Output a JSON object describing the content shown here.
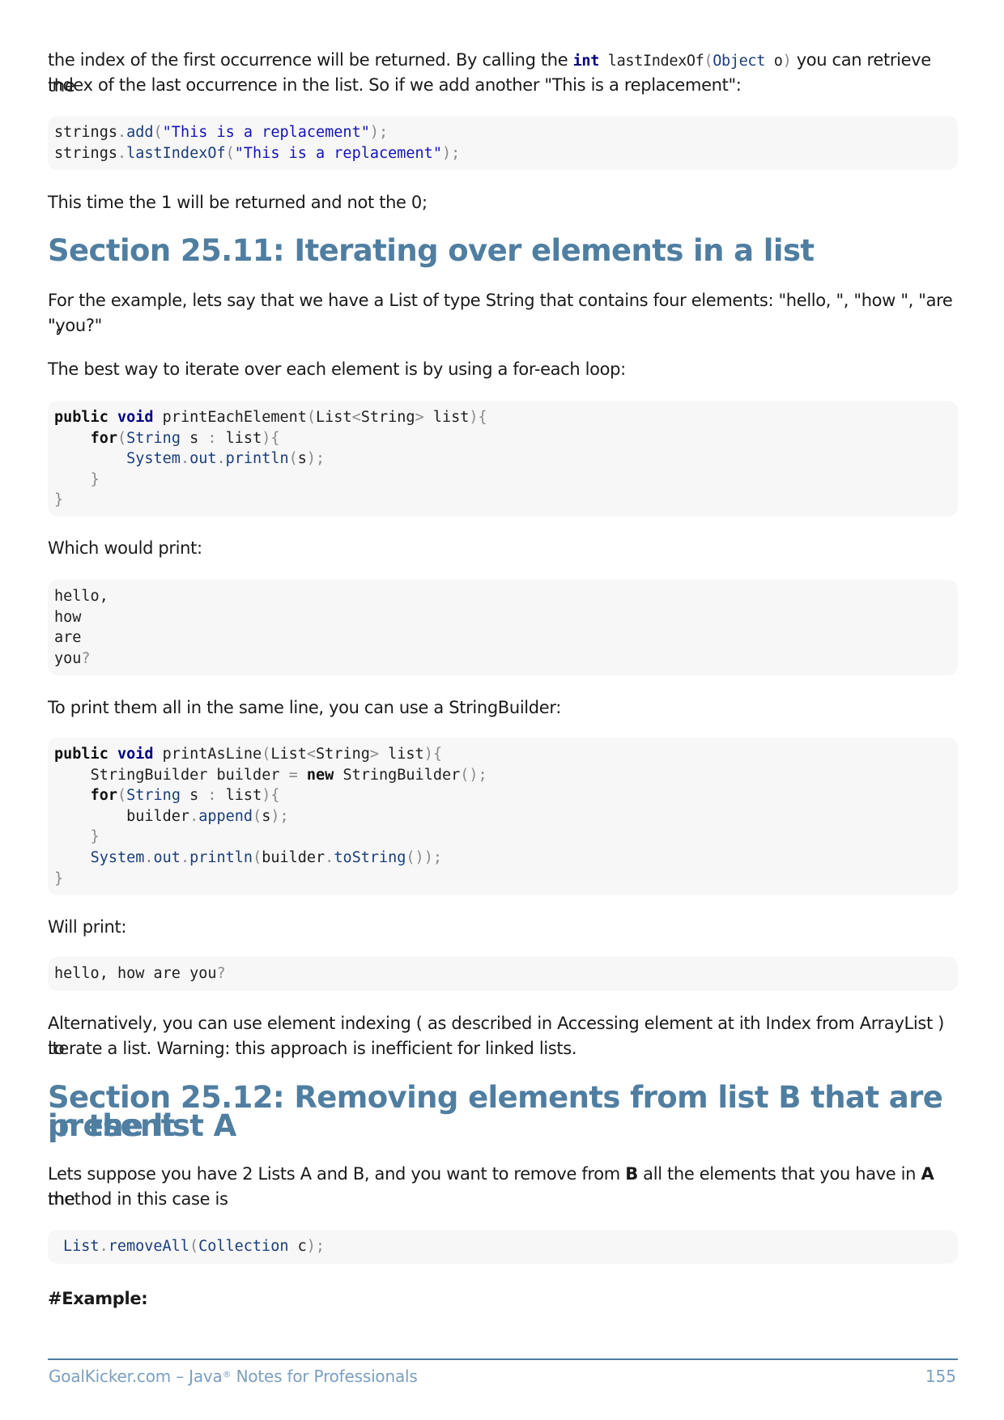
{
  "intro": {
    "line1_a": "the index of the first occurrence will be returned. By calling the ",
    "line1_kw": "int",
    "line1_fn": "lastIndexOf",
    "line1_open": "(",
    "line1_type": "Object",
    "line1_param": " o",
    "line1_close": ")",
    "line1_b": " you can retrieve the",
    "line2": "index of the last occurrence in the list. So if we add another \"This is a replacement\":"
  },
  "code1": {
    "l1_obj": "strings",
    "l1_fn": "add",
    "l1_str": "\"This is a replacement\"",
    "l2_obj": "strings",
    "l2_fn": "lastIndexOf",
    "l2_str": "\"This is a replacement\""
  },
  "after_code1": "This time the 1 will be returned and not the 0;",
  "section_25_11": {
    "title": "Section 25.11: Iterating over elements in a list",
    "para1_line1": "For the example, lets say that we have a List of type String that contains four elements: \"hello, \", \"how \", \"are \",",
    "para1_line2": "\"you?\"",
    "para2": "The best way to iterate over each element is by using a for-each loop:",
    "which_print": "Which would print:",
    "output_lines": [
      "hello,",
      "how",
      "are",
      "you"
    ],
    "output_q": "?",
    "same_line": "To print them all in the same line, you can use a StringBuilder:",
    "will_print": "Will print:",
    "output2": "hello, how are you",
    "alt_line1": "Alternatively, you can use element indexing ( as described in Accessing element at ith Index from ArrayList ) to",
    "alt_line2": "iterate a list. Warning: this approach is inefficient for linked lists."
  },
  "code2": {
    "kw_public": "public",
    "kw_void": "void",
    "fn": "printEachElement",
    "list_type": "List",
    "string_type": "String",
    "param": "list",
    "kw_for": "for",
    "loop_var": "s",
    "system": "System",
    "out": "out",
    "println": "println"
  },
  "code3": {
    "fn": "printAsLine",
    "builder_type": "StringBuilder",
    "builder_var": "builder",
    "kw_new": "new",
    "append": "append",
    "toString": "toString"
  },
  "section_25_12": {
    "title_line1": "Section 25.12: Removing elements from list B that are present",
    "title_line2": "in the list A",
    "para_a": "Lets suppose you have 2 Lists A and B, and you want to remove from ",
    "para_b_bold": "B",
    "para_c": " all the elements that you have in ",
    "para_a_bold": "A",
    "para_d": " the",
    "para_line2": "method in this case is",
    "code_obj": "List",
    "code_fn": "removeAll",
    "code_type": "Collection",
    "code_param": " c",
    "example": "#Example:"
  },
  "footer": {
    "left_a": "GoalKicker.com – Java",
    "left_sup": "®",
    "left_b": " Notes for Professionals",
    "page": "155"
  }
}
